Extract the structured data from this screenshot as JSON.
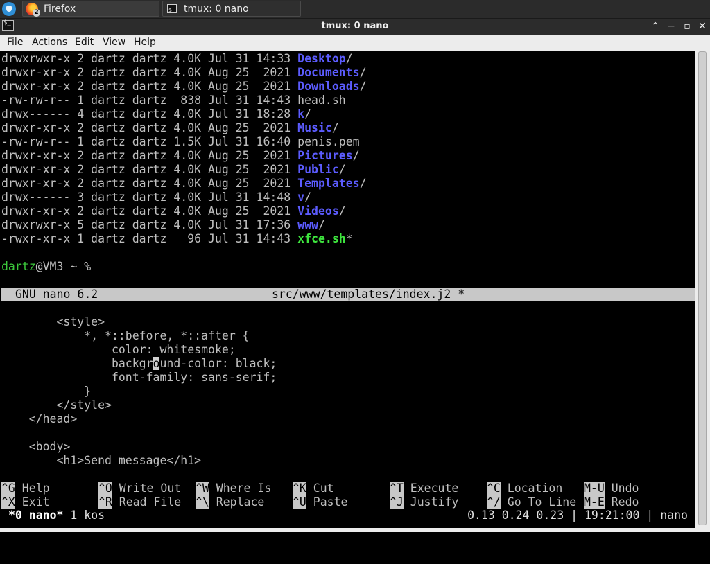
{
  "taskbar": {
    "firefox_label": "Firefox",
    "firefox_badge": "2",
    "tmux_label": "tmux: 0 nano"
  },
  "window": {
    "title": "tmux: 0 nano",
    "controls": {
      "up": "⌃",
      "minimize": "−",
      "maximize": "▫",
      "close": "✕"
    }
  },
  "menu": [
    "File",
    "Actions",
    "Edit",
    "View",
    "Help"
  ],
  "ls_rows": [
    {
      "perm": "drwxrwxr-x",
      "links": "2",
      "user": "dartz",
      "group": "dartz",
      "size": "4.0K",
      "month": "Jul",
      "day": "31",
      "time": "14:33",
      "name": "Desktop",
      "suffix": "/",
      "kind": "dir"
    },
    {
      "perm": "drwxr-xr-x",
      "links": "2",
      "user": "dartz",
      "group": "dartz",
      "size": "4.0K",
      "month": "Aug",
      "day": "25",
      "time": " 2021",
      "name": "Documents",
      "suffix": "/",
      "kind": "dir"
    },
    {
      "perm": "drwxr-xr-x",
      "links": "2",
      "user": "dartz",
      "group": "dartz",
      "size": "4.0K",
      "month": "Aug",
      "day": "25",
      "time": " 2021",
      "name": "Downloads",
      "suffix": "/",
      "kind": "dir"
    },
    {
      "perm": "-rw-rw-r--",
      "links": "1",
      "user": "dartz",
      "group": "dartz",
      "size": " 838",
      "month": "Jul",
      "day": "31",
      "time": "14:43",
      "name": "head.sh",
      "suffix": "",
      "kind": "file"
    },
    {
      "perm": "drwx------",
      "links": "4",
      "user": "dartz",
      "group": "dartz",
      "size": "4.0K",
      "month": "Jul",
      "day": "31",
      "time": "18:28",
      "name": "k",
      "suffix": "/",
      "kind": "dir"
    },
    {
      "perm": "drwxr-xr-x",
      "links": "2",
      "user": "dartz",
      "group": "dartz",
      "size": "4.0K",
      "month": "Aug",
      "day": "25",
      "time": " 2021",
      "name": "Music",
      "suffix": "/",
      "kind": "dir"
    },
    {
      "perm": "-rw-rw-r--",
      "links": "1",
      "user": "dartz",
      "group": "dartz",
      "size": "1.5K",
      "month": "Jul",
      "day": "31",
      "time": "16:40",
      "name": "penis.pem",
      "suffix": "",
      "kind": "file"
    },
    {
      "perm": "drwxr-xr-x",
      "links": "2",
      "user": "dartz",
      "group": "dartz",
      "size": "4.0K",
      "month": "Aug",
      "day": "25",
      "time": " 2021",
      "name": "Pictures",
      "suffix": "/",
      "kind": "dir"
    },
    {
      "perm": "drwxr-xr-x",
      "links": "2",
      "user": "dartz",
      "group": "dartz",
      "size": "4.0K",
      "month": "Aug",
      "day": "25",
      "time": " 2021",
      "name": "Public",
      "suffix": "/",
      "kind": "dir"
    },
    {
      "perm": "drwxr-xr-x",
      "links": "2",
      "user": "dartz",
      "group": "dartz",
      "size": "4.0K",
      "month": "Aug",
      "day": "25",
      "time": " 2021",
      "name": "Templates",
      "suffix": "/",
      "kind": "dir"
    },
    {
      "perm": "drwx------",
      "links": "3",
      "user": "dartz",
      "group": "dartz",
      "size": "4.0K",
      "month": "Jul",
      "day": "31",
      "time": "14:48",
      "name": "v",
      "suffix": "/",
      "kind": "dir"
    },
    {
      "perm": "drwxr-xr-x",
      "links": "2",
      "user": "dartz",
      "group": "dartz",
      "size": "4.0K",
      "month": "Aug",
      "day": "25",
      "time": " 2021",
      "name": "Videos",
      "suffix": "/",
      "kind": "dir"
    },
    {
      "perm": "drwxrwxr-x",
      "links": "5",
      "user": "dartz",
      "group": "dartz",
      "size": "4.0K",
      "month": "Jul",
      "day": "31",
      "time": "17:36",
      "name": "www",
      "suffix": "/",
      "kind": "dir"
    },
    {
      "perm": "-rwxr-xr-x",
      "links": "1",
      "user": "dartz",
      "group": "dartz",
      "size": "  96",
      "month": "Jul",
      "day": "31",
      "time": "14:43",
      "name": "xfce.sh",
      "suffix": "*",
      "kind": "exec"
    }
  ],
  "prompt": {
    "user": "dartz",
    "host": "@VM3 ~ %"
  },
  "nano": {
    "version": "GNU nano 6.2",
    "filename": "src/www/templates/index.j2 *",
    "lines": [
      "",
      "        <style>",
      "            *, *::before, *::after {",
      "                color: whitesmoke;",
      "                background-color: black;",
      "                font-family: sans-serif;",
      "            }",
      "        </style>",
      "    </head>",
      "",
      "    <body>",
      "        <h1>Send message</h1>"
    ],
    "cursor": {
      "line": 4,
      "col": 22
    },
    "shortcuts": [
      [
        {
          "key": "^G",
          "label": "Help"
        },
        {
          "key": "^O",
          "label": "Write Out"
        },
        {
          "key": "^W",
          "label": "Where Is"
        },
        {
          "key": "^K",
          "label": "Cut"
        },
        {
          "key": "^T",
          "label": "Execute"
        },
        {
          "key": "^C",
          "label": "Location"
        },
        {
          "key": "M-U",
          "label": "Undo"
        }
      ],
      [
        {
          "key": "^X",
          "label": "Exit"
        },
        {
          "key": "^R",
          "label": "Read File"
        },
        {
          "key": "^\\",
          "label": "Replace"
        },
        {
          "key": "^U",
          "label": "Paste"
        },
        {
          "key": "^J",
          "label": "Justify"
        },
        {
          "key": "^/",
          "label": "Go To Line"
        },
        {
          "key": "M-E",
          "label": "Redo"
        }
      ]
    ]
  },
  "tmux_status": {
    "window": "*0 nano*",
    "session": "1 kos",
    "load": "0.13 0.24 0.23",
    "time": "19:21:00",
    "host": "nano"
  },
  "colors": {
    "dir": "#5c5cff",
    "exec": "#3ee63e",
    "prompt_user": "#3cc83c",
    "separator": "#1fa01f"
  }
}
